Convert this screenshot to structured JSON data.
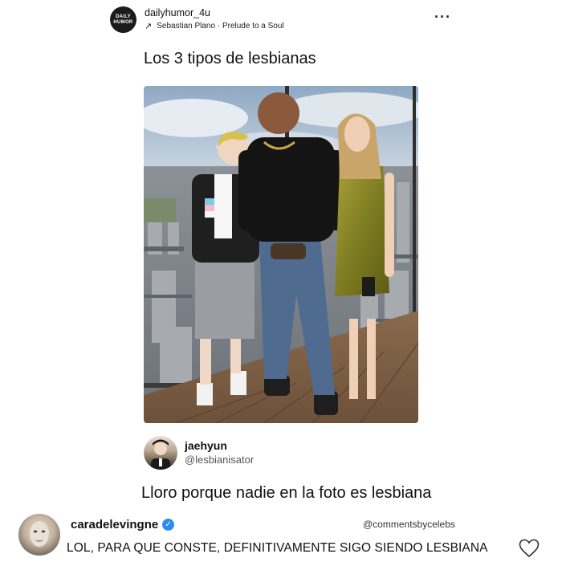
{
  "post": {
    "avatar_text_line1": "DAILY",
    "avatar_text_line2": "HUMOR",
    "username": "dailyhumor_4u",
    "audio_arrow": "↗",
    "audio_label": "Sebastian Plano · Prelude to a Soul",
    "more_icon": "more-horizontal-icon",
    "caption": "Los 3 tipos de lesbianas"
  },
  "reply": {
    "name": "jaehyun",
    "handle": "@lesbianisator",
    "text": "Lloro porque nadie en la foto es lesbiana"
  },
  "comment": {
    "name": "caradelevingne",
    "verified_icon": "verified-badge-icon",
    "source": "@commentsbycelebs",
    "text": "LOL, PARA QUE CONSTE, DEFINITIVAMENTE SIGO SIENDO LESBIANA",
    "like_icon": "heart-outline-icon"
  },
  "colors": {
    "verified": "#2e8bf0",
    "text": "#111111",
    "muted": "#555555"
  }
}
